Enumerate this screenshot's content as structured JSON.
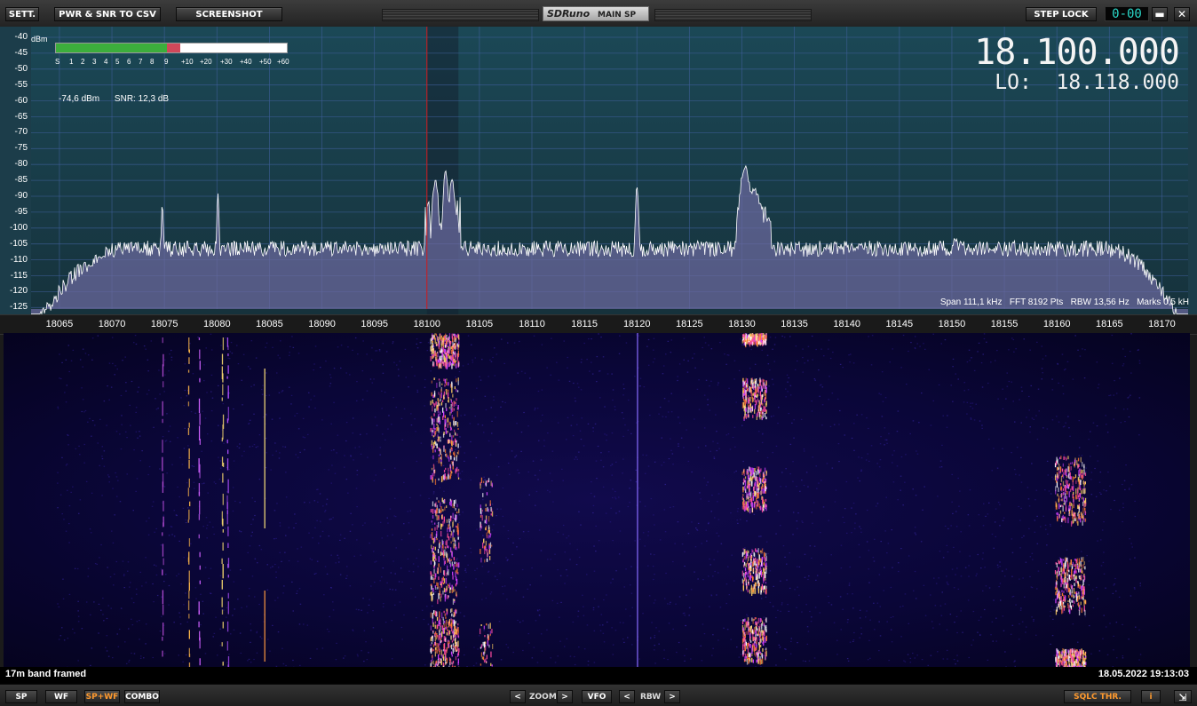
{
  "toolbar": {
    "settings_label": "SETT.",
    "pwr_snr_label": "PWR & SNR TO CSV",
    "screenshot_label": "SCREENSHOT",
    "brand_logo": "SDRuno",
    "brand_window": "MAIN SP",
    "step_lock_label": "STEP LOCK",
    "clock": "0-00",
    "minimize_label": "▬",
    "close_label": "✕"
  },
  "spectrum": {
    "unit": "dBm",
    "y_ticks": [
      "-40",
      "-45",
      "-50",
      "-55",
      "-60",
      "-65",
      "-70",
      "-75",
      "-80",
      "-85",
      "-90",
      "-95",
      "-100",
      "-105",
      "-110",
      "-115",
      "-120",
      "-125"
    ],
    "smeter": {
      "labels": [
        "S",
        "1",
        "2",
        "3",
        "4",
        "5",
        "6",
        "7",
        "8",
        "9",
        "+10",
        "+20",
        "+30",
        "+40",
        "+50",
        "+60"
      ],
      "level_percent": 48,
      "peak_percent": 54
    },
    "power": "-74,6 dBm",
    "snr": "SNR: 12,3 dB",
    "frequency": "18.100.000",
    "lo_label": "LO:",
    "lo_frequency": "18.118.000",
    "span": "Span 111,1 kHz",
    "fft": "FFT 8192 Pts",
    "rbw": "RBW 13,56 Hz",
    "marks": "Marks 0,5 kH",
    "fill_color": "#6c6aa0",
    "trace_color": "#ffffff",
    "tuning_line_color": "#d01818"
  },
  "freq_scale": [
    "18065",
    "18070",
    "18075",
    "18080",
    "18085",
    "18090",
    "18095",
    "18100",
    "18105",
    "18110",
    "18115",
    "18120",
    "18125",
    "18130",
    "18135",
    "18140",
    "18145",
    "18150",
    "18155",
    "18160",
    "18165",
    "18170"
  ],
  "waterfall": {
    "caption": "17m band framed",
    "timestamp": "18.05.2022 19:13:03"
  },
  "bottombar": {
    "sp_label": "SP",
    "wf_label": "WF",
    "spwf_label": "SP+WF",
    "combo_label": "COMBO",
    "zoom_prev": "<",
    "zoom_label": "ZOOM",
    "zoom_next": ">",
    "vfo_label": "VFO",
    "rbw_prev": "<",
    "rbw_label": "RBW",
    "rbw_next": ">",
    "sqlc_label": "SQLC THR.",
    "info_label": "i",
    "resize_label": "⇲"
  }
}
